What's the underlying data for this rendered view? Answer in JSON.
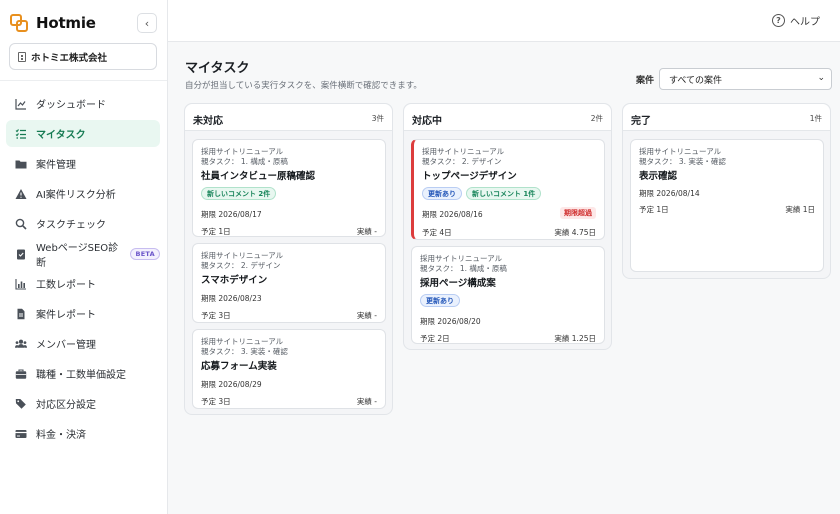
{
  "brand": {
    "name": "Hotmie",
    "accent": "#e8901f"
  },
  "sidebar": {
    "collapse_icon": "chevron-left-icon",
    "company": "ホトミエ株式会社",
    "items": [
      {
        "label": "ダッシュボード",
        "icon": "chart-line-icon"
      },
      {
        "label": "マイタスク",
        "icon": "task-list-icon",
        "active": true
      },
      {
        "label": "案件管理",
        "icon": "folder-icon"
      },
      {
        "label": "AI案件リスク分析",
        "icon": "warning-icon"
      },
      {
        "label": "タスクチェック",
        "icon": "search-icon"
      },
      {
        "label": "WebページSEO診断",
        "icon": "clipboard-check-icon",
        "badge": "BETA"
      },
      {
        "label": "工数レポート",
        "icon": "bar-chart-icon"
      },
      {
        "label": "案件レポート",
        "icon": "document-icon"
      },
      {
        "label": "メンバー管理",
        "icon": "users-icon"
      },
      {
        "label": "職種・工数単価設定",
        "icon": "briefcase-icon"
      },
      {
        "label": "対応区分設定",
        "icon": "tags-icon"
      },
      {
        "label": "料金・決済",
        "icon": "credit-card-icon"
      }
    ]
  },
  "topbar": {
    "help_label": "ヘルプ",
    "help_icon": "question-circle-icon"
  },
  "main": {
    "title": "マイタスク",
    "subtitle": "自分が担当している実行タスクを、案件横断で確認できます。",
    "filter": {
      "label": "案件",
      "selected": "すべての案件"
    }
  },
  "columns": [
    {
      "title": "未対応",
      "count": "3件",
      "cards": [
        {
          "project": "採用サイトリニューアル",
          "parent": "親タスク： 1. 構成・原稿",
          "title": "社員インタビュー原稿確認",
          "badges": [
            {
              "type": "comment",
              "label": "新しいコメント 2件"
            }
          ],
          "due": "期限 2026/08/17",
          "plan": "予定 1日",
          "actual": "実績 -"
        },
        {
          "project": "採用サイトリニューアル",
          "parent": "親タスク： 2. デザイン",
          "title": "スマホデザイン",
          "badges": [],
          "due": "期限 2026/08/23",
          "plan": "予定 3日",
          "actual": "実績 -"
        },
        {
          "project": "採用サイトリニューアル",
          "parent": "親タスク： 3. 実装・確認",
          "title": "応募フォーム実装",
          "badges": [],
          "due": "期限 2026/08/29",
          "plan": "予定 3日",
          "actual": "実績 -"
        }
      ]
    },
    {
      "title": "対応中",
      "count": "2件",
      "cards": [
        {
          "project": "採用サイトリニューアル",
          "parent": "親タスク： 2. デザイン",
          "title": "トップページデザイン",
          "badges": [
            {
              "type": "updated",
              "label": "更新あり"
            },
            {
              "type": "comment",
              "label": "新しいコメント 1件"
            }
          ],
          "due": "期限 2026/08/16",
          "overdue": "期限超過",
          "plan": "予定 4日",
          "actual": "実績 4.75日"
        },
        {
          "project": "採用サイトリニューアル",
          "parent": "親タスク： 1. 構成・原稿",
          "title": "採用ページ構成案",
          "badges": [
            {
              "type": "updated",
              "label": "更新あり"
            }
          ],
          "due": "期限 2026/08/20",
          "plan": "予定 2日",
          "actual": "実績 1.25日"
        }
      ]
    },
    {
      "title": "完了",
      "count": "1件",
      "cards": [
        {
          "project": "採用サイトリニューアル",
          "parent": "親タスク： 3. 実装・確認",
          "title": "表示確認",
          "badges": [],
          "due": "期限 2026/08/14",
          "plan": "予定 1日",
          "actual": "実績 1日"
        }
      ]
    }
  ],
  "colors": {
    "active_bg": "#e9f7f1",
    "active_text": "#157a52",
    "overdue": "#dc3c3c"
  }
}
